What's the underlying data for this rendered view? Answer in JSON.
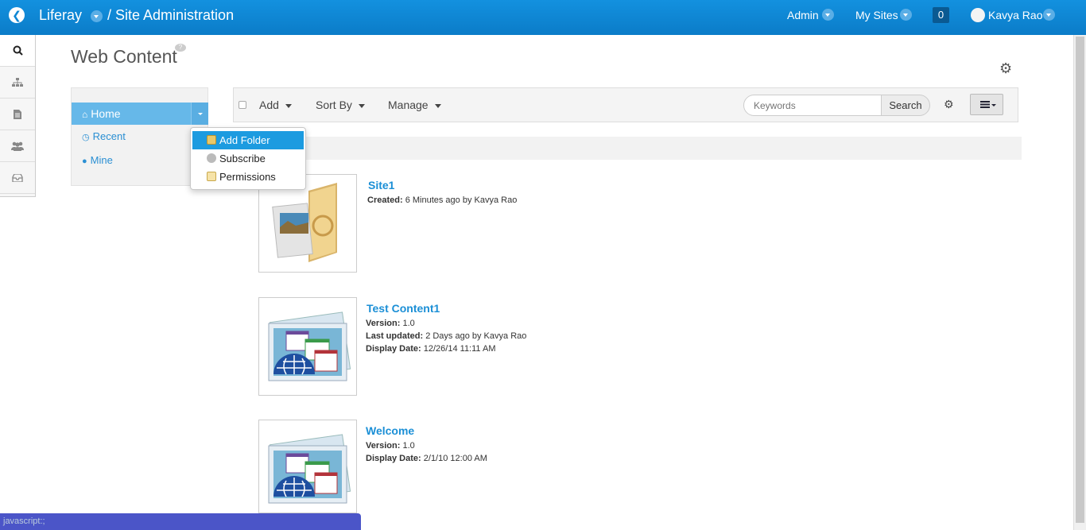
{
  "topbar": {
    "brand": "Liferay",
    "section": "/ Site Administration",
    "admin": "Admin",
    "my_sites": "My Sites",
    "notifications": "0",
    "user": "Kavya Rao"
  },
  "page": {
    "title": "Web Content",
    "help": "?"
  },
  "sidenav": {
    "home": "Home",
    "recent": "Recent",
    "mine": "Mine"
  },
  "dropdown": {
    "add_folder": "Add Folder",
    "subscribe": "Subscribe",
    "permissions": "Permissions"
  },
  "toolbar": {
    "add": "Add",
    "sort_by": "Sort By",
    "manage": "Manage",
    "search_placeholder": "Keywords",
    "search_button": "Search"
  },
  "entries": [
    {
      "title": "Site1",
      "created_label": "Created:",
      "created": "6 Minutes ago by Kavya Rao"
    },
    {
      "title": "Test Content1",
      "version_label": "Version:",
      "version": "1.0",
      "updated_label": "Last updated:",
      "updated": "2 Days ago by Kavya Rao",
      "display_label": "Display Date:",
      "display": "12/26/14 11:11 AM"
    },
    {
      "title": "Welcome",
      "version_label": "Version:",
      "version": "1.0",
      "display_label": "Display Date:",
      "display": "2/1/10 12:00 AM"
    }
  ],
  "status_bar": "javascript:;",
  "colors": {
    "topbar": "#0e86d4",
    "accent": "#1b8fd6",
    "nav_active": "#66b8e9"
  }
}
